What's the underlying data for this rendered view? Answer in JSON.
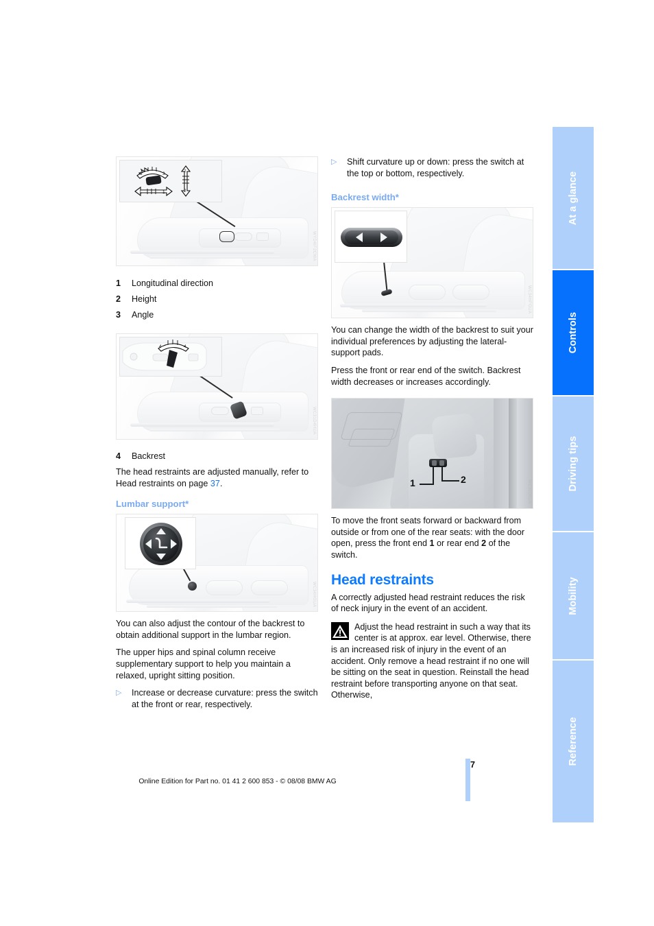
{
  "document": {
    "page_number": "37",
    "footer_text": "Online Edition for Part no. 01 41 2 600 853 - © 08/08 BMW AG"
  },
  "side_tabs": [
    {
      "label": "At a glance",
      "active": false
    },
    {
      "label": "Controls",
      "active": true
    },
    {
      "label": "Driving tips",
      "active": false
    },
    {
      "label": "Mobility",
      "active": false
    },
    {
      "label": "Reference",
      "active": false
    }
  ],
  "colors": {
    "heading": "#0d7aff",
    "subheading": "#7aaaf0",
    "tab_active": "#0671fc",
    "tab_inactive": "#aed0fa",
    "link": "#1a73e8"
  },
  "left_column": {
    "figure_seat_switch": {
      "code": "WYD4IF2CWA",
      "alt": "Seat adjustment switch with directions 1, 2, 3"
    },
    "legend": [
      {
        "num": "1",
        "label": "Longitudinal direction"
      },
      {
        "num": "2",
        "label": "Height"
      },
      {
        "num": "3",
        "label": "Angle"
      }
    ],
    "figure_backrest_switch": {
      "code": "WC31D4HUA",
      "alt": "Backrest adjustment switch"
    },
    "legend2": [
      {
        "num": "4",
        "label": "Backrest"
      }
    ],
    "head_restraints_note_pre": "The head restraints are adjusted manually, refer to Head restraints on page ",
    "head_restraints_note_link": "37",
    "head_restraints_note_post": ".",
    "lumbar_heading": "Lumbar support*",
    "figure_lumbar": {
      "code": "WC34HGUA",
      "alt": "Round four-way lumbar support switch with seat symbol"
    },
    "lumbar_p1": "You can also adjust the contour of the backrest to obtain additional support in the lumbar region.",
    "lumbar_p2": "The upper hips and spinal column receive supplementary support to help you maintain a relaxed, upright sitting position.",
    "lumbar_bullet": "Increase or decrease curvature: press the switch at the front or rear, respectively."
  },
  "right_column": {
    "shift_bullet": "Shift curvature up or down: press the switch at the top or bottom, respectively.",
    "backrest_width_heading": "Backrest width*",
    "figure_backrest_width": {
      "code": "WC34HFGUA",
      "alt": "Oval backrest width rocker switch with left and right arrows"
    },
    "backrest_p1": "You can change the width of the backrest to suit your individual preferences by adjusting the lateral-support pads.",
    "backrest_p2": "Press the front or rear end of the switch. Backrest width decreases or increases accordingly.",
    "figure_door_switch": {
      "code": "WC30D0UA",
      "alt": "Seat side switch viewed from the door opening, ends 1 and 2"
    },
    "door_switch_labels": [
      {
        "num": "1"
      },
      {
        "num": "2"
      }
    ],
    "move_seats_pre": "To move the front seats forward or backward from outside or from one of the rear seats: with the door open, press the front end ",
    "move_seats_bold1": "1",
    "move_seats_mid": " or rear end ",
    "move_seats_bold2": "2",
    "move_seats_post": " of the switch.",
    "head_restraints_heading": "Head restraints",
    "head_restraints_intro": "A correctly adjusted head restraint reduces the risk of neck injury in the event of an accident.",
    "warning_text": "Adjust the head restraint in such a way that its center is at approx. ear level. Otherwise, there is an increased risk of injury in the event of an accident. Only remove a head restraint if no one will be sitting on the seat in question. Reinstall the head restraint before transporting anyone on that seat. Otherwise,"
  }
}
